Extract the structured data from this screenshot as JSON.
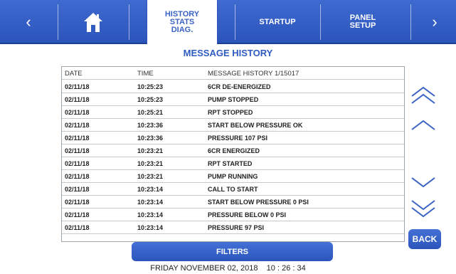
{
  "nav": {
    "prev_symbol": "‹",
    "next_symbol": "›",
    "tabs": [
      {
        "label": "HISTORY\nSTATS\nDIAG."
      },
      {
        "label": "STARTUP"
      },
      {
        "label": "PANEL\nSETUP"
      }
    ]
  },
  "title": "MESSAGE HISTORY",
  "table": {
    "header": {
      "date": "DATE",
      "time": "TIME",
      "message": "MESSAGE HISTORY 1/15017"
    },
    "rows": [
      {
        "date": "02/11/18",
        "time": "10:25:23",
        "message": "6CR DE-ENERGIZED"
      },
      {
        "date": "02/11/18",
        "time": "10:25:23",
        "message": "PUMP STOPPED"
      },
      {
        "date": "02/11/18",
        "time": "10:25:21",
        "message": "RPT STOPPED"
      },
      {
        "date": "02/11/18",
        "time": "10:23:36",
        "message": "START BELOW PRESSURE OK"
      },
      {
        "date": "02/11/18",
        "time": "10:23:36",
        "message": "PRESSURE 107   PSI"
      },
      {
        "date": "02/11/18",
        "time": "10:23:21",
        "message": "6CR ENERGIZED"
      },
      {
        "date": "02/11/18",
        "time": "10:23:21",
        "message": "RPT STARTED"
      },
      {
        "date": "02/11/18",
        "time": "10:23:21",
        "message": "PUMP RUNNING"
      },
      {
        "date": "02/11/18",
        "time": "10:23:14",
        "message": "CALL TO START"
      },
      {
        "date": "02/11/18",
        "time": "10:23:14",
        "message": "START BELOW PRESSURE 0   PSI"
      },
      {
        "date": "02/11/18",
        "time": "10:23:14",
        "message": "PRESSURE BELOW 0   PSI"
      },
      {
        "date": "02/11/18",
        "time": "10:23:14",
        "message": "PRESSURE 97   PSI"
      }
    ]
  },
  "buttons": {
    "back": "BACK",
    "filters": "FILTERS"
  },
  "footer": {
    "datetime": "FRIDAY NOVEMBER 02, 2018    10 : 26 : 34"
  },
  "icons": {
    "home": "home-icon",
    "page_up": "double-chevron-up-icon",
    "line_up": "chevron-up-icon",
    "line_down": "chevron-down-icon",
    "page_down": "double-chevron-down-icon"
  },
  "colors": {
    "accent": "#2e5bc3",
    "topbar": "#3a63c4",
    "border": "#9ba3ab"
  }
}
